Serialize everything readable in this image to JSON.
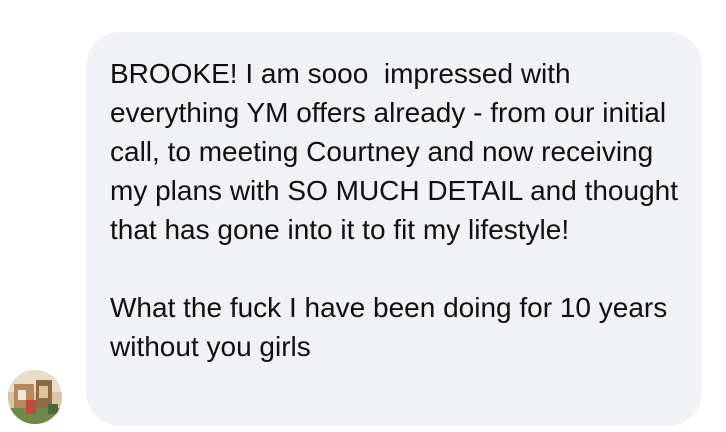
{
  "conversation": {
    "message": {
      "paragraph_1": "BROOKE! I am sooo  impressed with everything YM offers already - from our initial call, to meeting Courtney and now receiving my plans with SO MUCH DETAIL and thought that has gone into it to fit my lifestyle!",
      "paragraph_2": "What the fuck I have been doing for 10 years without you girls",
      "bubble_color": "#f1f2f6",
      "text_color": "#101010"
    },
    "sender": {
      "avatar_icon": "profile-photo-icon"
    }
  }
}
